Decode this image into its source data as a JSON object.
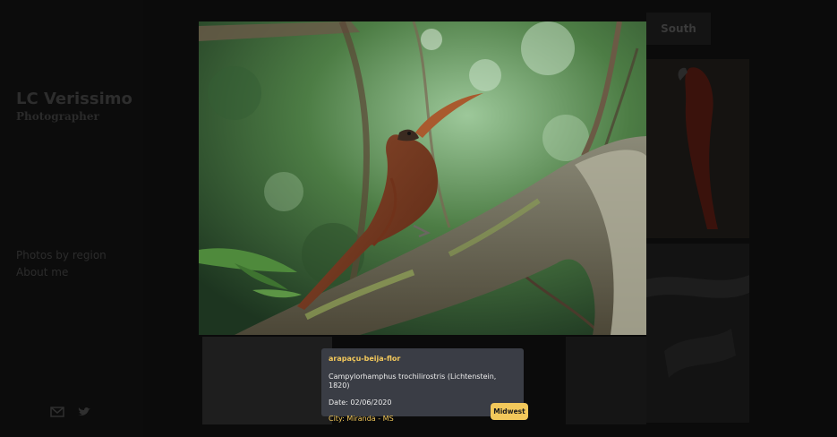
{
  "brand": {
    "name": "LC Verissimo",
    "subtitle": "Photographer"
  },
  "nav": {
    "items": [
      {
        "label": "Photos by region"
      },
      {
        "label": "About me"
      }
    ]
  },
  "icons": {
    "mail": "mail-icon",
    "twitter": "twitter-icon"
  },
  "region_tab": {
    "label": "South"
  },
  "lightbox": {
    "common_name": "arapaçu-beija-flor",
    "scientific_name": "Campylorhamphus trochilirostris (Lichtenstein, 1820)",
    "date": "Date: 02/06/2020",
    "city": "City: Miranda - MS",
    "region_badge": "Midwest"
  },
  "colors": {
    "accent": "#f2c85b",
    "card_bg": "#3a3d45",
    "page_bg": "#0b0b0b"
  }
}
